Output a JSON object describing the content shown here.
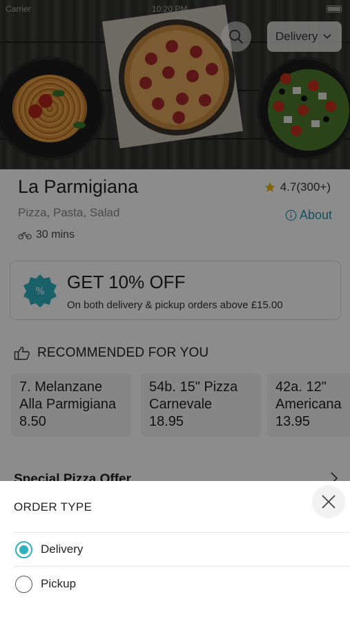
{
  "status_bar": {
    "carrier": "Carrier",
    "time": "10:20 PM"
  },
  "header": {
    "order_type_button": "Delivery"
  },
  "restaurant": {
    "name": "La Parmigiana",
    "rating": "4.7(300+)",
    "cuisine": "Pizza, Pasta, Salad",
    "about_label": "About",
    "eta": "30 mins"
  },
  "offer": {
    "headline": "GET 10% OFF",
    "details": "On both delivery & pickup orders above £15.00"
  },
  "recommended": {
    "heading": "RECOMMENDED FOR YOU",
    "items": [
      {
        "name_line1": "7. Melanzane",
        "name_line2": "Alla Parmigiana",
        "price": "8.50"
      },
      {
        "name_line1": "54b. 15\" Pizza",
        "name_line2": "Carnevale",
        "price": "18.95"
      },
      {
        "name_line1": "42a. 12\"",
        "name_line2": "Americana",
        "price": "13.95"
      }
    ]
  },
  "section_partial": {
    "label": "Special Pizza Offer"
  },
  "order_type_sheet": {
    "title": "ORDER TYPE",
    "options": [
      {
        "label": "Delivery",
        "selected": true
      },
      {
        "label": "Pickup",
        "selected": false
      }
    ]
  },
  "colors": {
    "accent": "#2fb0bf",
    "link": "#2b8fa8",
    "star": "#f0b400",
    "overlay": "rgba(0,0,0,0.45)"
  },
  "icons": [
    "search-icon",
    "chevron-down-icon",
    "star-icon",
    "info-icon",
    "bike-icon",
    "discount-badge-icon",
    "thumbs-up-icon",
    "chevron-right-icon",
    "close-icon"
  ]
}
